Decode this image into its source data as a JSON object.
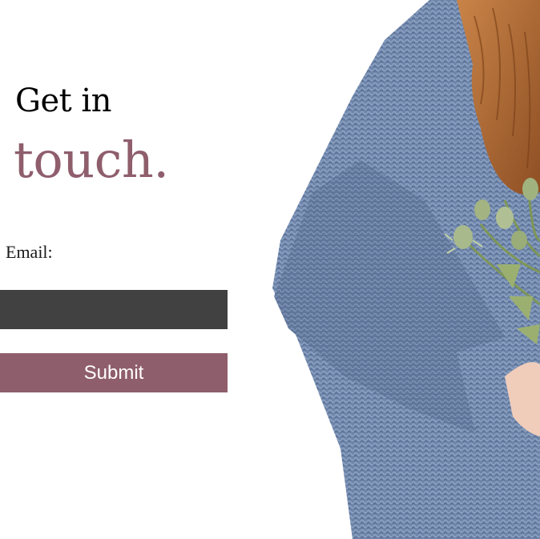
{
  "heading": {
    "line1": "Get in",
    "line2": "touch."
  },
  "form": {
    "email_label": "Email:",
    "email_value": "",
    "email_placeholder": "",
    "submit_label": "Submit"
  },
  "photo": {
    "description_icon": "photo-of-person-in-knit-sweater-holding-thistle-bouquet"
  },
  "colors": {
    "accent": "#8f5e6d",
    "input_bg": "#414141",
    "sweater": "#6c83a8",
    "hair": "#b06a35",
    "foliage": "#93a86b"
  }
}
